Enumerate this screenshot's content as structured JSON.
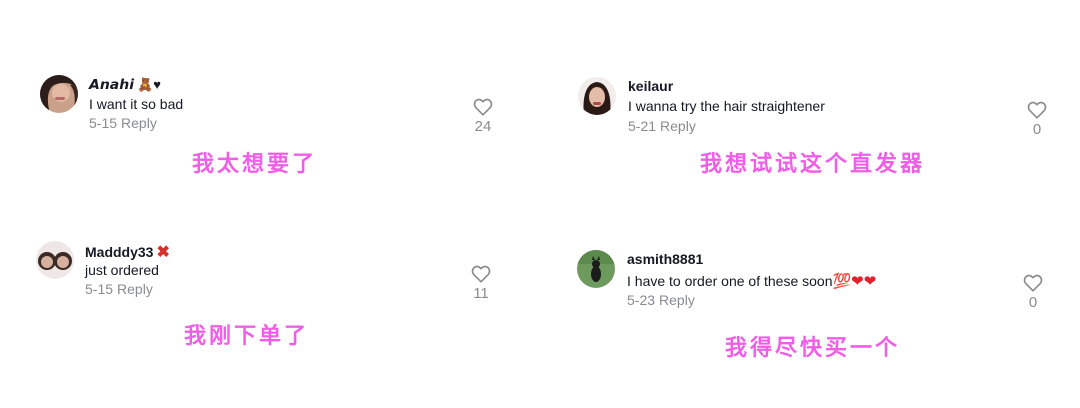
{
  "comments": [
    {
      "username": "𝘼𝙣𝙖𝙝𝙞",
      "username_emoji": "🧸♥",
      "text": "I want it so bad",
      "date": "5-15",
      "reply": "Reply",
      "likes": "24",
      "caption": "我太想要了"
    },
    {
      "username": "keilaur",
      "username_emoji": "",
      "text": "I wanna try the hair straightener",
      "date": "5-21",
      "reply": "Reply",
      "likes": "0",
      "caption": "我想试试这个直发器"
    },
    {
      "username": "Madddy33",
      "username_emoji": "✖",
      "text": "just ordered",
      "date": "5-15",
      "reply": "Reply",
      "likes": "11",
      "caption": "我刚下单了"
    },
    {
      "username": "asmith8881",
      "username_emoji": "",
      "text": "I have to order one of these soon",
      "text_emoji": "💯❤❤",
      "date": "5-23",
      "reply": "Reply",
      "likes": "0",
      "caption": "我得尽快买一个"
    }
  ],
  "colors": {
    "caption": "#f05ee8",
    "meta": "#8a8b91",
    "text": "#161823"
  }
}
